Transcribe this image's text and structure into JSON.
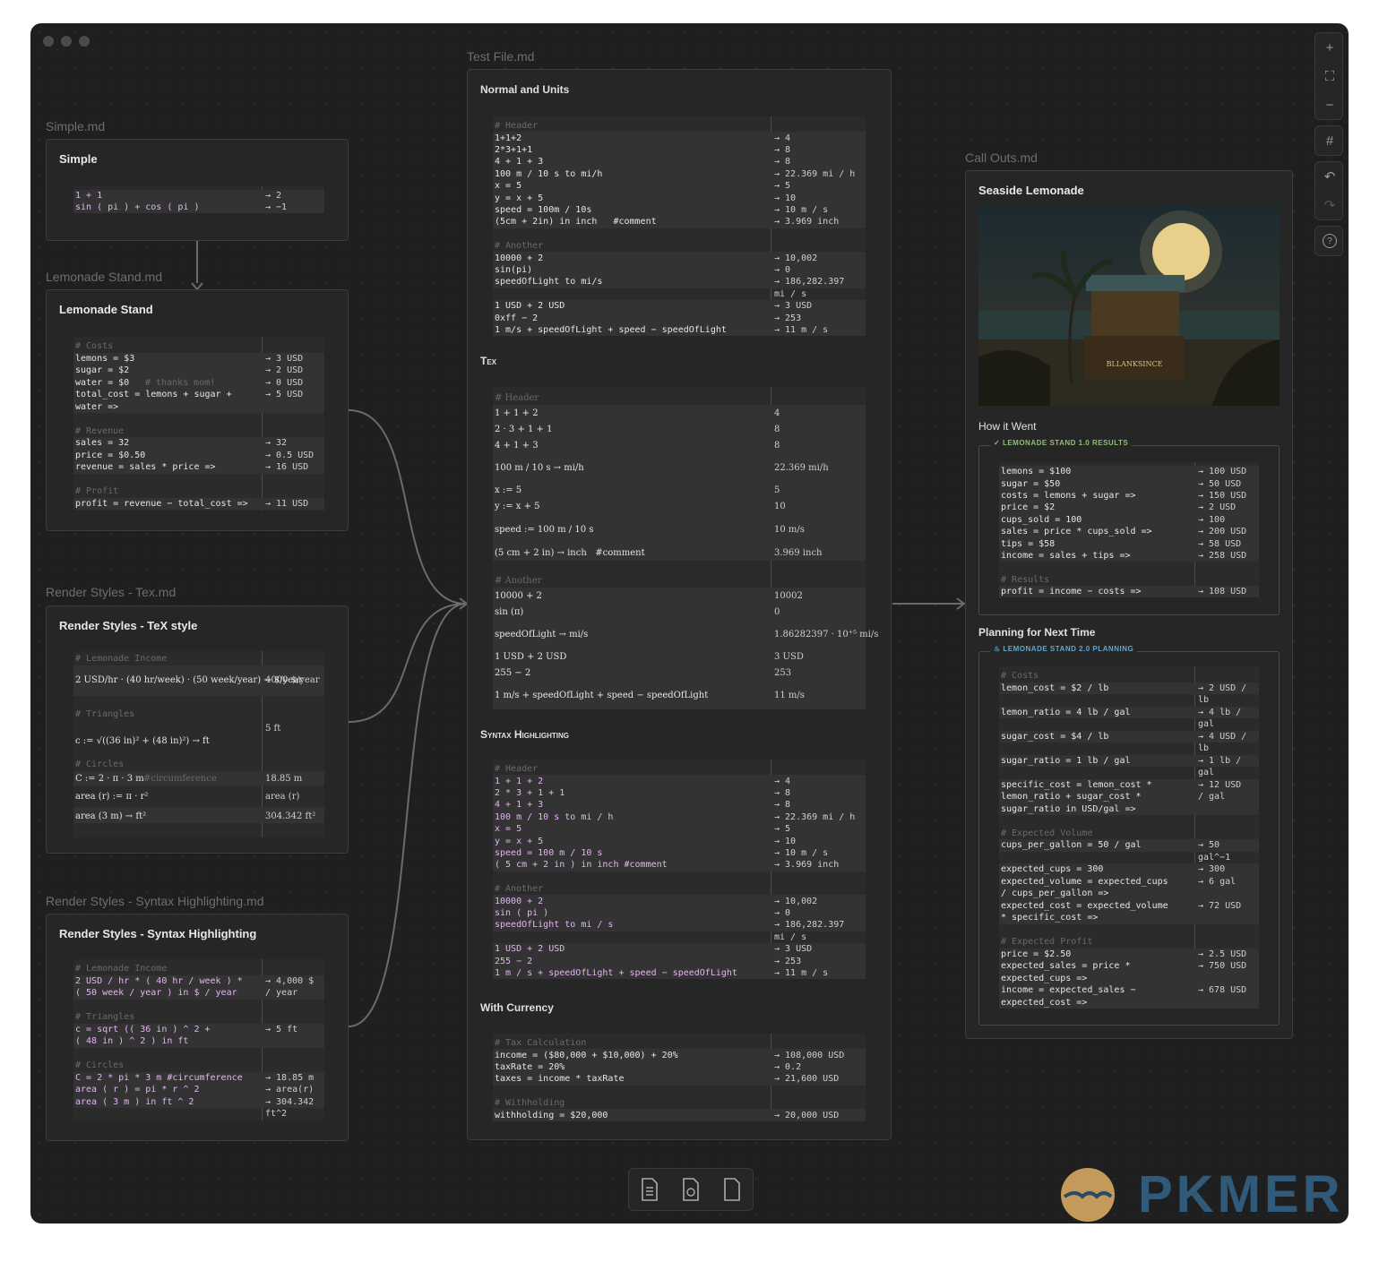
{
  "files": {
    "simple": "Simple.md",
    "lemonade": "Lemonade Stand.md",
    "tex": "Render Styles - Tex.md",
    "syntax": "Render Styles - Syntax Highlighting.md",
    "test": "Test File.md",
    "callouts": "Call Outs.md"
  },
  "cards": {
    "simple": {
      "title": "Simple",
      "rows": [
        [
          "1 + 1",
          "→ 2"
        ],
        [
          "sin ( pi ) + cos ( pi )",
          "→ −1"
        ]
      ]
    },
    "lemonade": {
      "title": "Lemonade Stand",
      "rows": [
        [
          "# Costs",
          ""
        ],
        [
          "lemons = $3",
          "→ 3 USD"
        ],
        [
          "sugar = $2",
          "→ 2 USD"
        ],
        [
          "water = $0",
          "→ 0 USD"
        ],
        [
          "total_cost = lemons + sugar +",
          "→ 5 USD"
        ],
        [
          "water =>",
          ""
        ],
        [
          "",
          ""
        ],
        [
          "# Revenue",
          ""
        ],
        [
          "sales = 32",
          "→ 32"
        ],
        [
          "price = $0.50",
          "→ 0.5 USD"
        ],
        [
          "revenue = sales * price =>",
          "→ 16 USD"
        ],
        [
          "",
          ""
        ],
        [
          "# Profit",
          ""
        ],
        [
          "profit = revenue − total_cost =>",
          "→ 11 USD"
        ]
      ],
      "water_comment": "# thanks mom!"
    },
    "tex": {
      "title": "Render Styles - TeX style",
      "h_income": "# Lemonade Income",
      "income_expr": "2 USD/hr · (40 hr/week) · (50 week/year) → $/year",
      "income_val": "4000 $/year",
      "h_tri": "# Triangles",
      "tri_expr": "c := √((36 in)² + (48 in)²) → ft",
      "tri_val": "5 ft",
      "h_circ": "# Circles",
      "circ1": "C := 2 · π · 3 m",
      "circ1_comment": "#circumference",
      "circ1_val": "18.85 m",
      "circ2": "area (r) := π · r²",
      "circ2_val": "area (r)",
      "circ3": "area (3 m) → ft²",
      "circ3_val": "304.342 ft²"
    },
    "syntax": {
      "title": "Render Styles - Syntax Highlighting",
      "rows": [
        [
          "# Lemonade Income",
          ""
        ],
        [
          "2 USD / hr * ( 40 hr / week ) *",
          "→ 4,000 $"
        ],
        [
          "( 50 week / year ) in $ / year",
          "/ year"
        ],
        [
          "",
          ""
        ],
        [
          "# Triangles",
          ""
        ],
        [
          "c = sqrt (( 36 in ) ^ 2 +",
          "→ 5 ft"
        ],
        [
          "( 48 in ) ^ 2 ) in ft",
          ""
        ],
        [
          "",
          ""
        ],
        [
          "# Circles",
          ""
        ],
        [
          "C = 2 * pi * 3 m #circumference",
          "→ 18.85 m"
        ],
        [
          "area ( r ) = pi * r ^ 2",
          "→ area(r)"
        ],
        [
          "area ( 3 m ) in ft ^ 2",
          "→ 304.342"
        ],
        [
          "",
          "ft^2"
        ]
      ]
    },
    "test": {
      "sec1": "Normal and Units",
      "normal": [
        [
          "# Header",
          ""
        ],
        [
          "1+1+2",
          "→ 4"
        ],
        [
          "2*3+1+1",
          "→ 8"
        ],
        [
          "4 + 1 + 3",
          "→ 8"
        ],
        [
          "100 m / 10 s to mi/h",
          "→ 22.369 mi / h"
        ],
        [
          "x = 5",
          "→ 5"
        ],
        [
          "y = x + 5",
          "→ 10"
        ],
        [
          "speed = 100m / 10s",
          "→ 10 m / s"
        ],
        [
          "(5cm + 2in) in inch   #comment",
          "→ 3.969 inch"
        ],
        [
          "",
          ""
        ],
        [
          "# Another",
          ""
        ],
        [
          "10000 + 2",
          "→ 10,002"
        ],
        [
          "sin(pi)",
          "→ 0"
        ],
        [
          "speedOfLight to mi/s",
          "→ 186,282.397"
        ],
        [
          "",
          "mi / s"
        ],
        [
          "1 USD + 2 USD",
          "→ 3 USD"
        ],
        [
          "0xff − 2",
          "→ 253"
        ],
        [
          "1 m/s + speedOfLight + speed − speedOfLight",
          "→ 11 m / s"
        ]
      ],
      "sec2": "Tex",
      "tex": [
        [
          "# Header",
          "",
          16
        ],
        [
          "1 + 1 + 2",
          "4",
          18
        ],
        [
          "2 · 3 + 1 + 1",
          "8",
          18
        ],
        [
          "4 + 1 + 3",
          "8",
          18
        ],
        [
          "100 m / 10 s → mi/h",
          "22.369 mi/h",
          32
        ],
        [
          "x := 5",
          "5",
          18
        ],
        [
          "y := x + 5",
          "10",
          18
        ],
        [
          "speed := 100 m / 10 s",
          "10 m/s",
          34
        ],
        [
          "(5 cm + 2 in) → inch   #comment",
          "3.969 inch",
          18
        ],
        [
          "",
          "",
          14
        ],
        [
          "# Another",
          "",
          16
        ],
        [
          "10000 + 2",
          "10002",
          18
        ],
        [
          "sin (π)",
          "0",
          18
        ],
        [
          "speedOfLight → mi/s",
          "1.86282397 · 10⁺⁵ mi/s",
          32
        ],
        [
          "1 USD + 2 USD",
          "3 USD",
          18
        ],
        [
          "255 − 2",
          "253",
          18
        ],
        [
          "1 m/s + speedOfLight + speed − speedOfLight",
          "11 m/s",
          32
        ]
      ],
      "sec3": "Syntax Highlighting",
      "syntax": [
        [
          "# Header",
          ""
        ],
        [
          "1 + 1 + 2",
          "→ 4"
        ],
        [
          "2 * 3 + 1 + 1",
          "→ 8"
        ],
        [
          "4 + 1 + 3",
          "→ 8"
        ],
        [
          "100 m / 10 s to mi / h",
          "→ 22.369 mi / h"
        ],
        [
          "x = 5",
          "→ 5"
        ],
        [
          "y = x + 5",
          "→ 10"
        ],
        [
          "speed = 100 m / 10 s",
          "→ 10 m / s"
        ],
        [
          "( 5 cm + 2 in ) in inch #comment",
          "→ 3.969 inch"
        ],
        [
          "",
          ""
        ],
        [
          "# Another",
          ""
        ],
        [
          "10000 + 2",
          "→ 10,002"
        ],
        [
          "sin ( pi )",
          "→ 0"
        ],
        [
          "speedOfLight to mi / s",
          "→ 186,282.397"
        ],
        [
          "",
          "mi / s"
        ],
        [
          "1 USD + 2 USD",
          "→ 3 USD"
        ],
        [
          "255 − 2",
          "→ 253"
        ],
        [
          "1 m / s + speedOfLight + speed − speedOfLight",
          "→ 11 m / s"
        ]
      ],
      "sec4": "With Currency",
      "currency": [
        [
          "# Tax Calculation",
          ""
        ],
        [
          "income = ($80,000 + $10,000) + 20%",
          "→ 108,000 USD"
        ],
        [
          "taxRate = 20%",
          "→ 0.2"
        ],
        [
          "taxes = income * taxRate",
          "→ 21,600 USD"
        ],
        [
          "",
          ""
        ],
        [
          "# Withholding",
          ""
        ],
        [
          "withholding = $20,000",
          "→ 20,000 USD"
        ]
      ]
    },
    "callouts": {
      "title": "Seaside Lemonade",
      "stand_sign": "BLLANKSINCE",
      "how": "How it Went",
      "c1_title": "LEMONADE STAND 1.0 RESULTS",
      "c1": [
        [
          "lemons = $100",
          "→ 100 USD"
        ],
        [
          "sugar = $50",
          "→ 50 USD"
        ],
        [
          "costs = lemons + sugar =>",
          "→ 150 USD"
        ],
        [
          "price = $2",
          "→ 2 USD"
        ],
        [
          "cups_sold = 100",
          "→ 100"
        ],
        [
          "sales = price * cups_sold =>",
          "→ 200 USD"
        ],
        [
          "tips = $58",
          "→ 58 USD"
        ],
        [
          "income = sales + tips =>",
          "→ 258 USD"
        ],
        [
          "",
          ""
        ],
        [
          "# Results",
          ""
        ],
        [
          "profit = income − costs =>",
          "→ 108 USD"
        ]
      ],
      "planning": "Planning for Next Time",
      "c2_title": "LEMONADE STAND 2.0 PLANNING",
      "c2": [
        [
          "# Costs",
          ""
        ],
        [
          "lemon_cost = $2 / lb",
          "→ 2 USD /"
        ],
        [
          "",
          "lb"
        ],
        [
          "lemon_ratio = 4 lb / gal",
          "→ 4 lb /"
        ],
        [
          "",
          "gal"
        ],
        [
          "sugar_cost = $4 / lb",
          "→ 4 USD /"
        ],
        [
          "",
          "lb"
        ],
        [
          "sugar_ratio = 1 lb / gal",
          "→ 1 lb /"
        ],
        [
          "",
          "gal"
        ],
        [
          "specific_cost = lemon_cost *",
          "→ 12 USD"
        ],
        [
          "lemon_ratio + sugar_cost *",
          "/ gal"
        ],
        [
          "sugar_ratio in USD/gal =>",
          ""
        ],
        [
          "",
          ""
        ],
        [
          "# Expected Volume",
          ""
        ],
        [
          "cups_per_gallon = 50 / gal",
          "→ 50"
        ],
        [
          "",
          "gal^−1"
        ],
        [
          "expected_cups = 300",
          "→ 300"
        ],
        [
          "expected_volume = expected_cups",
          "→ 6 gal"
        ],
        [
          "/ cups_per_gallon =>",
          ""
        ],
        [
          "expected_cost = expected_volume",
          "→ 72 USD"
        ],
        [
          "* specific_cost =>",
          ""
        ],
        [
          "",
          ""
        ],
        [
          "# Expected Profit",
          ""
        ],
        [
          "price = $2.50",
          "→ 2.5 USD"
        ],
        [
          "expected_sales = price *",
          "→ 750 USD"
        ],
        [
          "expected_cups =>",
          ""
        ],
        [
          "income = expected_sales −",
          "→ 678 USD"
        ],
        [
          "expected_cost =>",
          ""
        ]
      ]
    }
  },
  "toolbar": {
    "zoom_in": "+",
    "fit": "⛶",
    "zoom_out": "−",
    "grid": "#",
    "undo": "↶",
    "redo": "↷",
    "help": "?"
  },
  "watermark": "PKMER"
}
